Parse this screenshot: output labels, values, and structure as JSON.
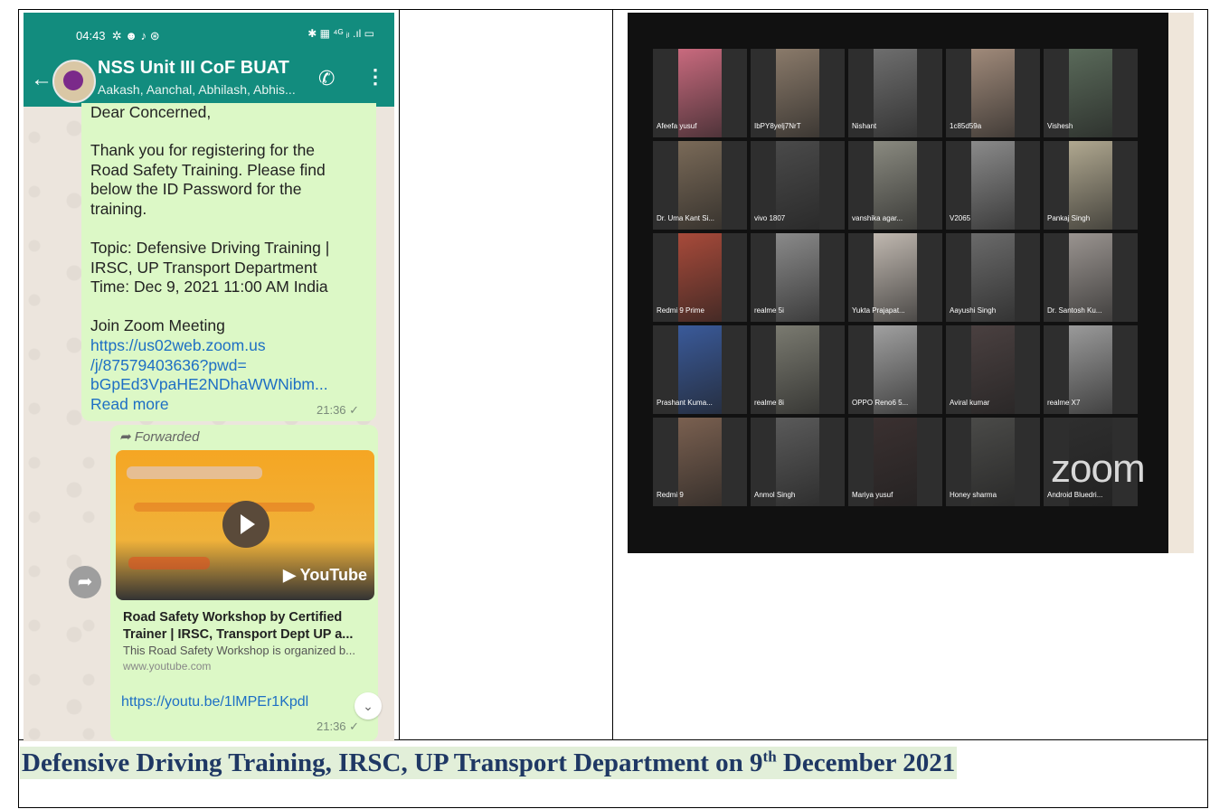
{
  "whatsapp": {
    "status_time": "04:43",
    "status_icons": "✲ ☻ ♪ ⊛",
    "status_right": "✱ ▦ ⁴ᴳ ᵢₗ .ıl ▭",
    "group_name": "NSS Unit III CoF BUAT",
    "group_members": "Aakash, Aanchal, Abhilash, Abhis...",
    "message": {
      "greeting": "Dear Concerned,",
      "body": "Thank you for registering for the\nRoad Safety Training. Please find\nbelow the ID Password for the\ntraining.",
      "topic": "Topic: Defensive Driving Training |\nIRSC, UP Transport Department\nTime: Dec 9, 2021 11:00 AM India",
      "join": "Join Zoom Meeting",
      "link": "https://us02web.zoom.us\n/j/87579403636?pwd=\nbGpEd3VpaHE2NDhaWWNibm...",
      "read_more": "Read more",
      "time": "21:36 ✓"
    },
    "forwarded": {
      "label": "Forwarded",
      "yt_logo": "YouTube",
      "title": "Road Safety Workshop by Certified\nTrainer | IRSC, Transport Dept UP a...",
      "description": "This Road Safety Workshop is organized b...",
      "domain": "www.youtube.com",
      "link": "https://youtu.be/1lMPEr1Kpdl",
      "time": "21:36 ✓"
    }
  },
  "zoom": {
    "logo": "zoom",
    "participants": [
      {
        "name": "Afeefa yusuf",
        "color": "#c96a7e"
      },
      {
        "name": "IbPY8yelj7NrT",
        "color": "#8a7a6a"
      },
      {
        "name": "Nishant",
        "color": "#6e6e6e"
      },
      {
        "name": "1c85d59a",
        "color": "#a08a7a"
      },
      {
        "name": "Vishesh",
        "color": "#5a6a5a"
      },
      {
        "name": "Dr. Uma Kant Si...",
        "color": "#7a6a58"
      },
      {
        "name": "vivo 1807",
        "color": "#4a4a4a"
      },
      {
        "name": "vanshika agar...",
        "color": "#8a8a80"
      },
      {
        "name": "V2065",
        "color": "#8a8a8a"
      },
      {
        "name": "Pankaj Singh",
        "color": "#b0a890"
      },
      {
        "name": "Redmi 9 Prime",
        "color": "#a84a3a"
      },
      {
        "name": "realme 5i",
        "color": "#8a8a8a"
      },
      {
        "name": "Yukta Prajapat...",
        "color": "#c0b8b0"
      },
      {
        "name": "Aayushi Singh",
        "color": "#6a6a6a"
      },
      {
        "name": "Dr. Santosh Ku...",
        "color": "#9a9490"
      },
      {
        "name": "Prashant Kuma...",
        "color": "#3a5a9a"
      },
      {
        "name": "realme 8i",
        "color": "#7a7a70"
      },
      {
        "name": "OPPO Reno6 5...",
        "color": "#a0a0a0"
      },
      {
        "name": "Aviral kumar",
        "color": "#4a4040"
      },
      {
        "name": "realme X7",
        "color": "#9a9a9a"
      },
      {
        "name": "Redmi 9",
        "color": "#7a6050"
      },
      {
        "name": "Anmol Singh",
        "color": "#5a5a5a"
      },
      {
        "name": "Mariya yusuf",
        "color": "#3a3030"
      },
      {
        "name": "Honey sharma",
        "color": "#4a4a48"
      },
      {
        "name": "Android Bluedri...",
        "color": "#2e2e2e"
      }
    ]
  },
  "caption": {
    "text_before": "Defensive Driving Training, IRSC, UP Transport Department on 9",
    "superscript": "th",
    "text_after": " December 2021"
  }
}
